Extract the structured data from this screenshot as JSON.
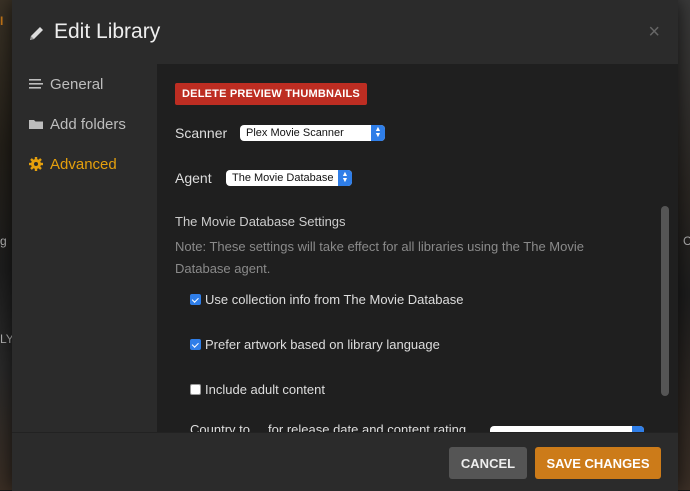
{
  "background": {
    "left_top": "I",
    "left_mid_1": "g",
    "left_mid_2": "LY",
    "right_mid_1": "C"
  },
  "modal": {
    "title": "Edit Library",
    "close_symbol": "×"
  },
  "sidebar": {
    "items": [
      {
        "label": "General",
        "icon": "list-icon"
      },
      {
        "label": "Add folders",
        "icon": "folder-icon"
      },
      {
        "label": "Advanced",
        "icon": "gear-icon",
        "active": true
      }
    ]
  },
  "content": {
    "delete_button": "DELETE PREVIEW THUMBNAILS",
    "scanner_label": "Scanner",
    "scanner_value": "Plex Movie Scanner",
    "agent_label": "Agent",
    "agent_value": "The Movie Database",
    "settings_title": "The Movie Database Settings",
    "note": "Note: These settings will take effect for all libraries using the The Movie Database agent.",
    "options": [
      {
        "label": "Use collection info from The Movie Database",
        "checked": true
      },
      {
        "label": "Prefer artwork based on library language",
        "checked": true
      },
      {
        "label": "Include adult content",
        "checked": false
      }
    ],
    "partial_row": "Country to ... for release date and content rating"
  },
  "footer": {
    "cancel": "CANCEL",
    "save": "SAVE CHANGES"
  },
  "colors": {
    "accent": "#cc7b19",
    "active_nav": "#e5a00d",
    "danger": "#bd2d22",
    "select_blue": "#2f7ee8"
  }
}
